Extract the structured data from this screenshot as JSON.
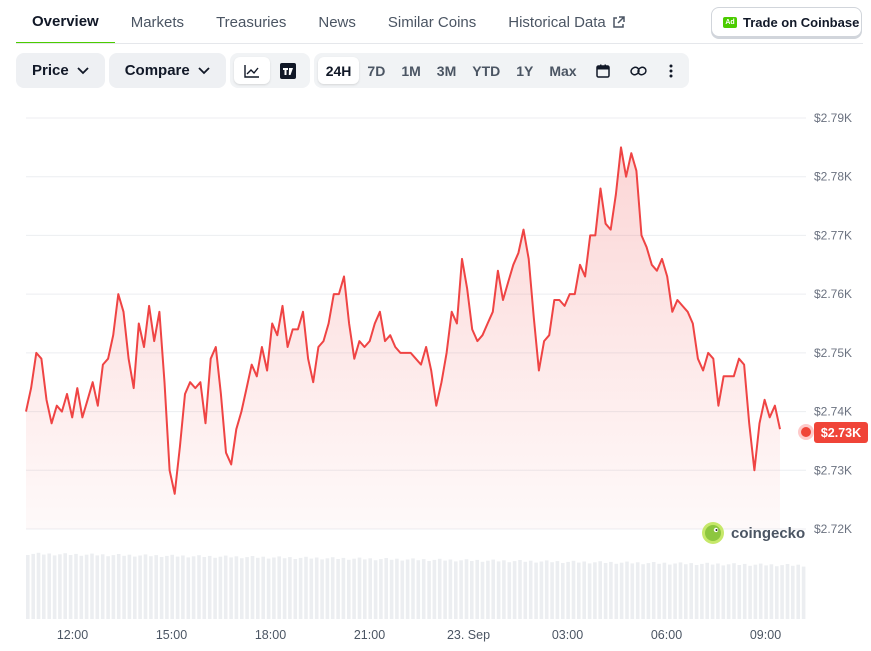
{
  "tabs": [
    {
      "label": "Overview",
      "active": true
    },
    {
      "label": "Markets"
    },
    {
      "label": "Treasuries"
    },
    {
      "label": "News"
    },
    {
      "label": "Similar Coins"
    },
    {
      "label": "Historical Data",
      "external": true
    }
  ],
  "trade_button": {
    "ad": "Ad",
    "label": "Trade on Coinbase"
  },
  "toolbar": {
    "price_label": "Price",
    "compare_label": "Compare",
    "chart_icons": [
      "line-chart-icon",
      "tradingview-icon"
    ],
    "ranges": [
      "24H",
      "7D",
      "1M",
      "3M",
      "YTD",
      "1Y",
      "Max"
    ],
    "active_range": "24H",
    "extra_icons": [
      "calendar-icon",
      "link-icon",
      "more-icon"
    ]
  },
  "colors": {
    "accent": "#4bcc00",
    "line": "#ef4444",
    "current": "#f04438"
  },
  "watermark": "coingecko",
  "current_price_label": "$2.73K",
  "chart_data": {
    "type": "area",
    "ylim": [
      2720,
      2790
    ],
    "y_ticks": [
      2790,
      2780,
      2770,
      2760,
      2750,
      2740,
      2730,
      2720
    ],
    "y_tick_labels": [
      "$2.79K",
      "$2.78K",
      "$2.77K",
      "$2.76K",
      "$2.75K",
      "$2.74K",
      "$2.73K",
      "$2.72K"
    ],
    "x_tick_labels": [
      "12:00",
      "15:00",
      "18:00",
      "21:00",
      "23. Sep",
      "03:00",
      "06:00",
      "09:00"
    ],
    "x_tick_hours": [
      12,
      15,
      18,
      21,
      24,
      27,
      30,
      33
    ],
    "x_range_hours": [
      10.5,
      34.5
    ],
    "grid": true,
    "series": [
      {
        "values": [
          2740,
          2744,
          2750,
          2749,
          2742,
          2738,
          2741,
          2740,
          2743,
          2739,
          2744,
          2739,
          2742,
          2745,
          2741,
          2748,
          2749,
          2753,
          2760,
          2757,
          2749,
          2744,
          2755,
          2751,
          2758,
          2752,
          2757,
          2745,
          2730,
          2726,
          2734,
          2743,
          2745,
          2744,
          2745,
          2738,
          2749,
          2751,
          2743,
          2733,
          2731,
          2737,
          2740,
          2744,
          2748,
          2746,
          2751,
          2747,
          2755,
          2753,
          2758,
          2751,
          2754,
          2754,
          2757,
          2749,
          2745,
          2751,
          2752,
          2755,
          2760,
          2760,
          2763,
          2755,
          2749,
          2752,
          2751,
          2752,
          2755,
          2757,
          2752,
          2753,
          2751,
          2750,
          2750,
          2750,
          2749,
          2748,
          2751,
          2747,
          2741,
          2745,
          2750,
          2757,
          2755,
          2766,
          2761,
          2754,
          2752,
          2753,
          2755,
          2757,
          2764,
          2759,
          2762,
          2765,
          2767,
          2771,
          2766,
          2756,
          2747,
          2752,
          2753,
          2759,
          2759,
          2758,
          2760,
          2760,
          2765,
          2763,
          2770,
          2770,
          2778,
          2772,
          2771,
          2777,
          2785,
          2780,
          2784,
          2781,
          2770,
          2768,
          2765,
          2764,
          2766,
          2763,
          2757,
          2759,
          2758,
          2757,
          2755,
          2749,
          2747,
          2750,
          2749,
          2741,
          2746,
          2746,
          2746,
          2749,
          2748,
          2738,
          2730,
          2738,
          2742,
          2739,
          2741,
          2737
        ]
      }
    ]
  }
}
